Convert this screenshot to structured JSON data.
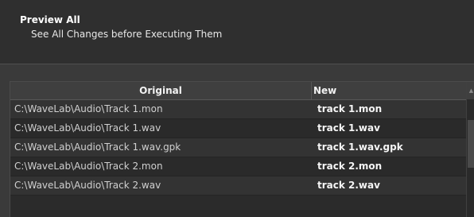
{
  "header": {
    "title": "Preview All",
    "subtitle": "See All Changes before Executing Them"
  },
  "table": {
    "columns": {
      "original": "Original",
      "new": "New"
    },
    "rows": [
      {
        "original": "C:\\WaveLab\\Audio\\Track 1.mon",
        "new": "track 1.mon"
      },
      {
        "original": "C:\\WaveLab\\Audio\\Track 1.wav",
        "new": "track 1.wav"
      },
      {
        "original": "C:\\WaveLab\\Audio\\Track 1.wav.gpk",
        "new": "track 1.wav.gpk"
      },
      {
        "original": "C:\\WaveLab\\Audio\\Track 2.mon",
        "new": "track 2.mon"
      },
      {
        "original": "C:\\WaveLab\\Audio\\Track 2.wav",
        "new": "track 2.wav"
      }
    ]
  },
  "scrollbar": {
    "up_icon": "chevron-up-icon"
  }
}
